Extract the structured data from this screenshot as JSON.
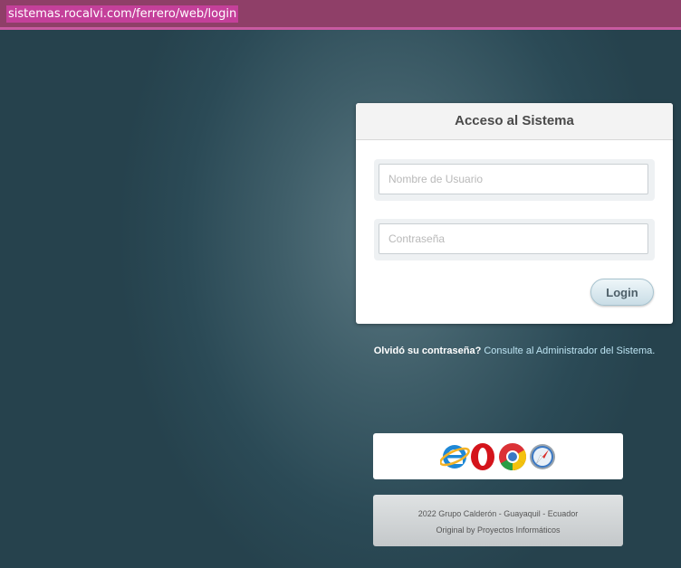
{
  "browser": {
    "url": "sistemas.rocalvi.com/ferrero/web/login"
  },
  "login": {
    "title": "Acceso al Sistema",
    "username_placeholder": "Nombre de Usuario",
    "username_value": "",
    "password_placeholder": "Contraseña",
    "password_value": "",
    "submit_label": "Login"
  },
  "forgot": {
    "question": "Olvidó su contraseña?",
    "link_text": "Consulte al Administrador del Sistema."
  },
  "supported_browsers": [
    {
      "name": "internet-explorer-icon",
      "color": "#1e88d6"
    },
    {
      "name": "opera-icon",
      "color": "#d4141b"
    },
    {
      "name": "chrome-icon",
      "color": "#2a9d45"
    },
    {
      "name": "safari-icon",
      "color": "#3a78c4"
    }
  ],
  "footer": {
    "line1": "2022  Grupo Calderón  -  Guayaquil - Ecuador",
    "line2": "Original by  Proyectos Informáticos"
  }
}
